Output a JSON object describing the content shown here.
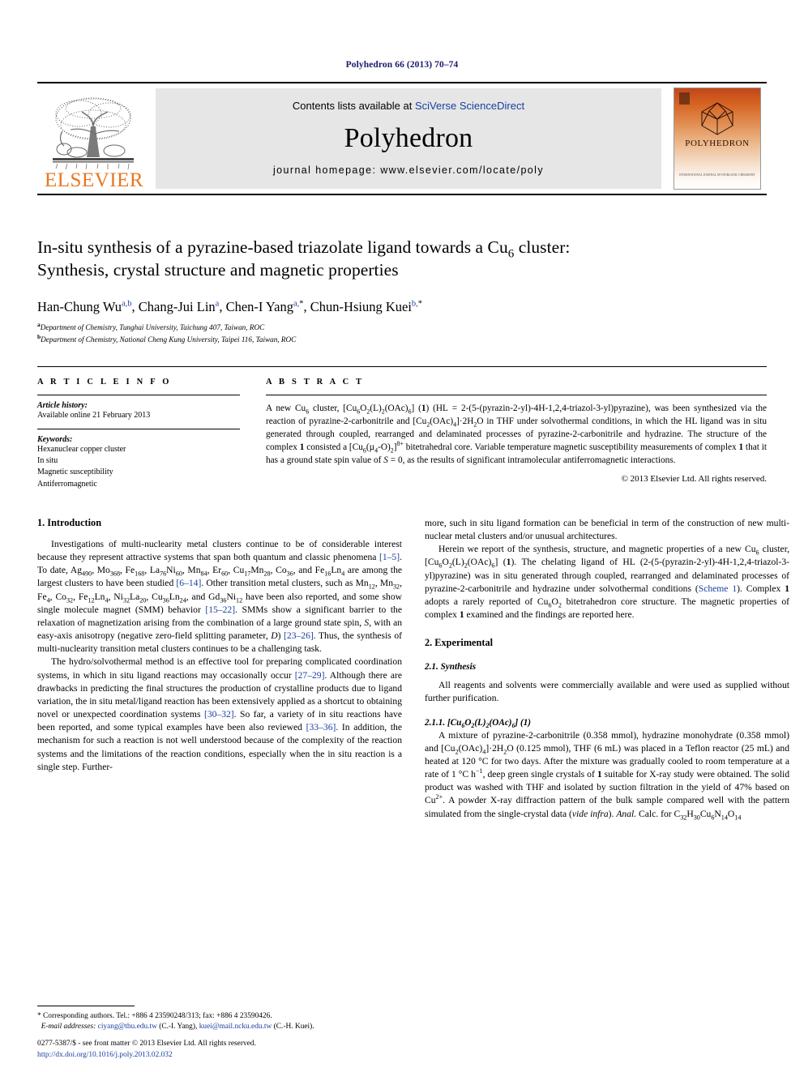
{
  "running_head": "Polyhedron 66 (2013) 70–74",
  "masthead": {
    "publisher_name": "ELSEVIER",
    "contents_prefix": "Contents lists available at ",
    "contents_link": "SciVerse ScienceDirect",
    "journal_name": "Polyhedron",
    "homepage": "journal homepage: www.elsevier.com/locate/poly",
    "cover_title": "POLYHEDRON",
    "cover_footer": "INTERNATIONAL JOURNAL OF\nINORGANIC CHEMISTRY"
  },
  "article": {
    "title": "In-situ synthesis of a pyrazine-based triazolate ligand towards a Cu6 cluster: Synthesis, crystal structure and magnetic properties",
    "title_line1_pre": "In-situ synthesis of a pyrazine-based triazolate ligand towards a Cu",
    "title_line1_sub": "6",
    "title_line1_post": " cluster:",
    "title_line2": "Synthesis, crystal structure and magnetic properties",
    "authors_raw": "Han-Chung Wu a,b, Chang-Jui Lin a, Chen-I Yang a,*, Chun-Hsiung Kuei b,*",
    "affiliation_a": "Department of Chemistry, Tunghai University, Taichung 407, Taiwan, ROC",
    "affiliation_b": "Department of Chemistry, National Cheng Kung University, Taipei 116, Taiwan, ROC"
  },
  "article_info": {
    "heading": "A R T I C L E   I N F O",
    "history_label": "Article history:",
    "history_value": "Available online 21 February 2013",
    "keywords_label": "Keywords:",
    "keywords": [
      "Hexanuclear copper cluster",
      "In situ",
      "Magnetic susceptibility",
      "Antiferromagnetic"
    ]
  },
  "abstract": {
    "heading": "A B S T R A C T",
    "body": "A new Cu6 cluster, [Cu6O2(L)2(OAc)6] (1) (HL = 2-(5-(pyrazin-2-yl)-4H-1,2,4-triazol-3-yl)pyrazine), was been synthesized via the reaction of pyrazine-2-carbonitrile and [Cu2(OAc)4]·2H2O in THF under solvothermal conditions, in which the HL ligand was in situ generated through coupled, rearranged and delaminated processes of pyrazine-2-carbonitrile and hydrazine. The structure of the complex 1 consisted a [Cu6(µ4-O)2]8+ bitetrahedral core. Variable temperature magnetic susceptibility measurements of complex 1 that it has a ground state spin value of S = 0, as the results of significant intramolecular antiferromagnetic interactions.",
    "copyright": "© 2013 Elsevier Ltd. All rights reserved."
  },
  "sections": {
    "introduction_heading": "1. Introduction",
    "intro_p1": "Investigations of multi-nuclearity metal clusters continue to be of considerable interest because they represent attractive systems that span both quantum and classic phenomena [1–5]. To date, Ag490, Mo368, Fe168, La76Ni60, Mn84, Er60, Cu17Mn28, Co36, and Fe16Ln4 are among the largest clusters to have been studied [6–14]. Other transition metal clusters, such as Mn12, Mn32, Fe4, Co32, Fe12Ln4, Ni32La20, Cu36Ln24, and Gd36Ni12 have been also reported, and some show single molecule magnet (SMM) behavior [15–22]. SMMs show a significant barrier to the relaxation of magnetization arising from the combination of a large ground state spin, S, with an easy-axis anisotropy (negative zero-field splitting parameter, D) [23–26]. Thus, the synthesis of multi-nuclearity transition metal clusters continues to be a challenging task.",
    "intro_p2": "The hydro/solvothermal method is an effective tool for preparing complicated coordination systems, in which in situ ligand reactions may occasionally occur [27–29]. Although there are drawbacks in predicting the final structures the production of crystalline products due to ligand variation, the in situ metal/ligand reaction has been extensively applied as a shortcut to obtaining novel or unexpected coordination systems [30–32]. So far, a variety of in situ reactions have been reported, and some typical examples have been also reviewed [33–36]. In addition, the mechanism for such a reaction is not well understood because of the complexity of the reaction systems and the limitations of the reaction conditions, especially when the in situ reaction is a single step. Further-",
    "intro_p2_cont": "more, such in situ ligand formation can be beneficial in term of the construction of new multi-nuclear metal clusters and/or unusual architectures.",
    "intro_p3": "Herein we report of the synthesis, structure, and magnetic properties of a new Cu6 cluster, [Cu6O2(L)2(OAc)6] (1). The chelating ligand of HL (2-(5-(pyrazin-2-yl)-4H-1,2,4-triazol-3-yl)pyrazine) was in situ generated through coupled, rearranged and delaminated processes of pyrazine-2-carbonitrile and hydrazine under solvothermal conditions (Scheme 1). Complex 1 adopts a rarely reported of Cu6O2 bitetrahedron core structure. The magnetic properties of complex 1 examined and the findings are reported here.",
    "experimental_heading": "2. Experimental",
    "synthesis_heading": "2.1. Synthesis",
    "synthesis_p1": "All reagents and solvents were commercially available and were used as supplied without further purification.",
    "compound_heading": "2.1.1. [Cu6O2(L)2(OAc)6] (1)",
    "compound_p1": "A mixture of pyrazine-2-carbonitrile (0.358 mmol), hydrazine monohydrate (0.358 mmol) and [Cu2(OAc)4]·2H2O (0.125 mmol), THF (6 mL) was placed in a Teflon reactor (25 mL) and heated at 120 °C for two days. After the mixture was gradually cooled to room temperature at a rate of 1 °C h−1, deep green single crystals of 1 suitable for X-ray study were obtained. The solid product was washed with THF and isolated by suction filtration in the yield of 47% based on Cu2+. A powder X-ray diffraction pattern of the bulk sample compared well with the pattern simulated from the single-crystal data (vide infra). Anal. Calc. for C32H30Cu6N14O14"
  },
  "footnotes": {
    "corresponding": "* Corresponding authors. Tel.: +886 4 23590248/313; fax: +886 4 23590426.",
    "email_label": "E-mail addresses:",
    "email1": "ciyang@thu.edu.tw",
    "email1_name": "(C.-I. Yang)",
    "email2": "kuei@mail.ncku.edu.tw",
    "email2_name": "(C.-H. Kuei).",
    "issn_line": "0277-5387/$ - see front matter © 2013 Elsevier Ltd. All rights reserved.",
    "doi": "http://dx.doi.org/10.1016/j.poly.2013.02.032"
  },
  "colors": {
    "link_blue": "#1a3fa0",
    "running_head_blue": "#1a1a6e",
    "elsevier_orange": "#E87722",
    "masthead_gray": "#e6e6e6"
  }
}
